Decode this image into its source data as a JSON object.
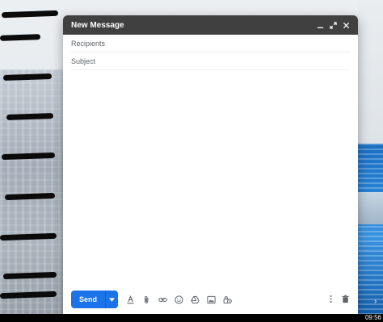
{
  "compose": {
    "title": "New Message",
    "recipients_placeholder": "Recipients",
    "subject_placeholder": "Subject",
    "send_label": "Send"
  },
  "icons": {
    "minimize": "minimize-icon",
    "expand": "expand-icon",
    "close": "close-icon",
    "send_options": "chevron-down-icon",
    "formatting": "format-text-icon",
    "attach": "paperclip-icon",
    "link": "link-icon",
    "emoji": "emoji-icon",
    "drive": "drive-icon",
    "photo": "photo-icon",
    "confidential": "lock-clock-icon",
    "more": "more-vertical-icon",
    "discard": "trash-icon"
  },
  "colors": {
    "header_bg": "#404040",
    "send_blue": "#1a73e8",
    "icon_gray": "#5f6368"
  },
  "taskbar": {
    "clock": "09:56"
  }
}
